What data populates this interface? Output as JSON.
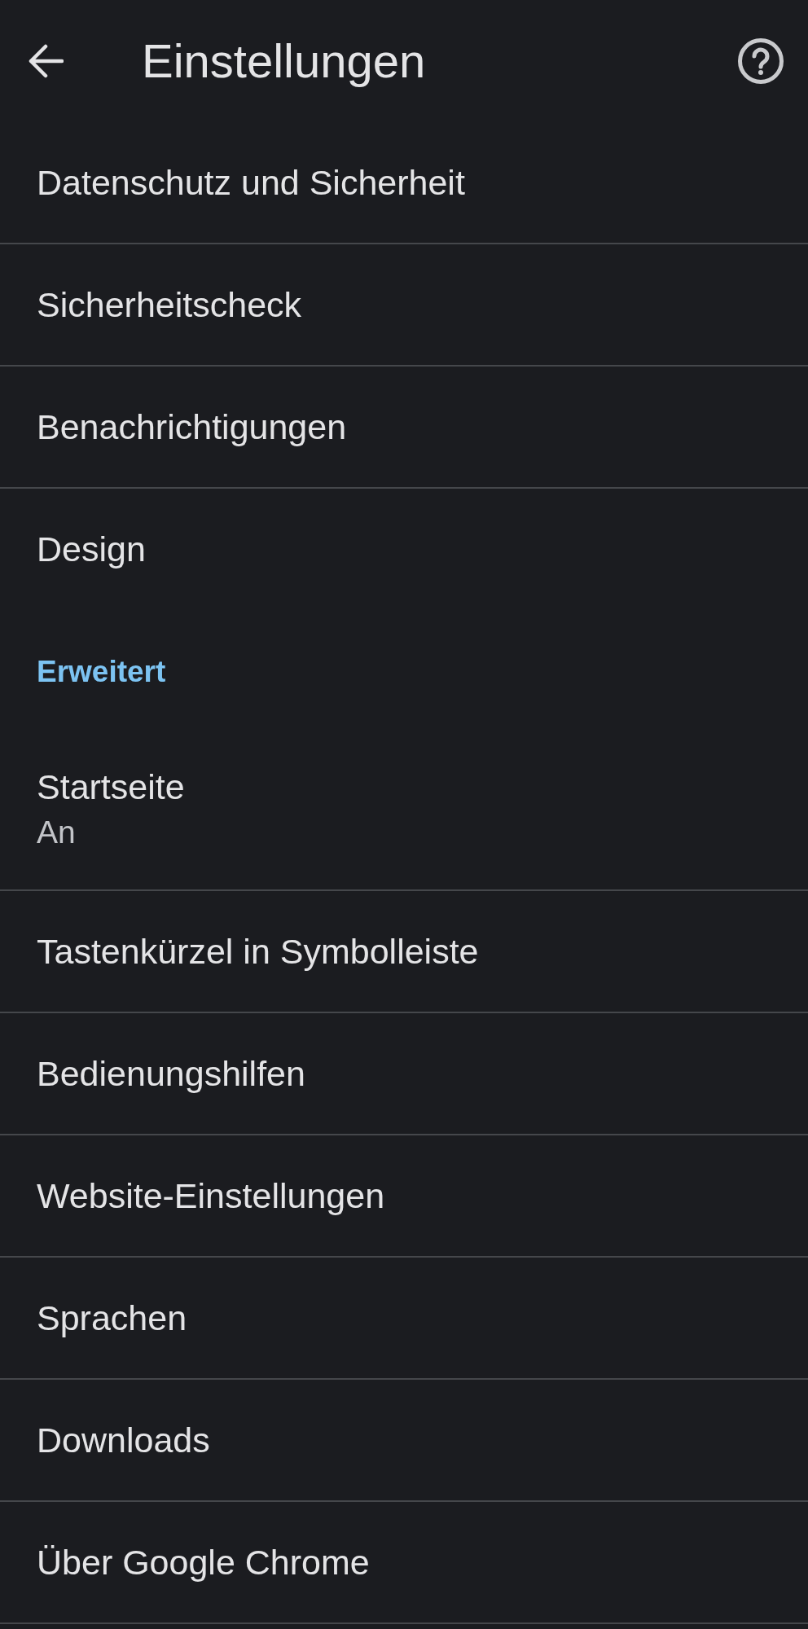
{
  "header": {
    "title": "Einstellungen"
  },
  "sections": [
    {
      "items": [
        {
          "label": "Datenschutz und Sicherheit"
        },
        {
          "label": "Sicherheitscheck"
        },
        {
          "label": "Benachrichtigungen"
        },
        {
          "label": "Design"
        }
      ]
    },
    {
      "heading": "Erweitert",
      "items": [
        {
          "label": "Startseite",
          "summary": "An"
        },
        {
          "label": "Tastenkürzel in Symbolleiste"
        },
        {
          "label": "Bedienungshilfen"
        },
        {
          "label": "Website-Einstellungen"
        },
        {
          "label": "Sprachen"
        },
        {
          "label": "Downloads"
        },
        {
          "label": "Über Google Chrome"
        }
      ]
    }
  ]
}
